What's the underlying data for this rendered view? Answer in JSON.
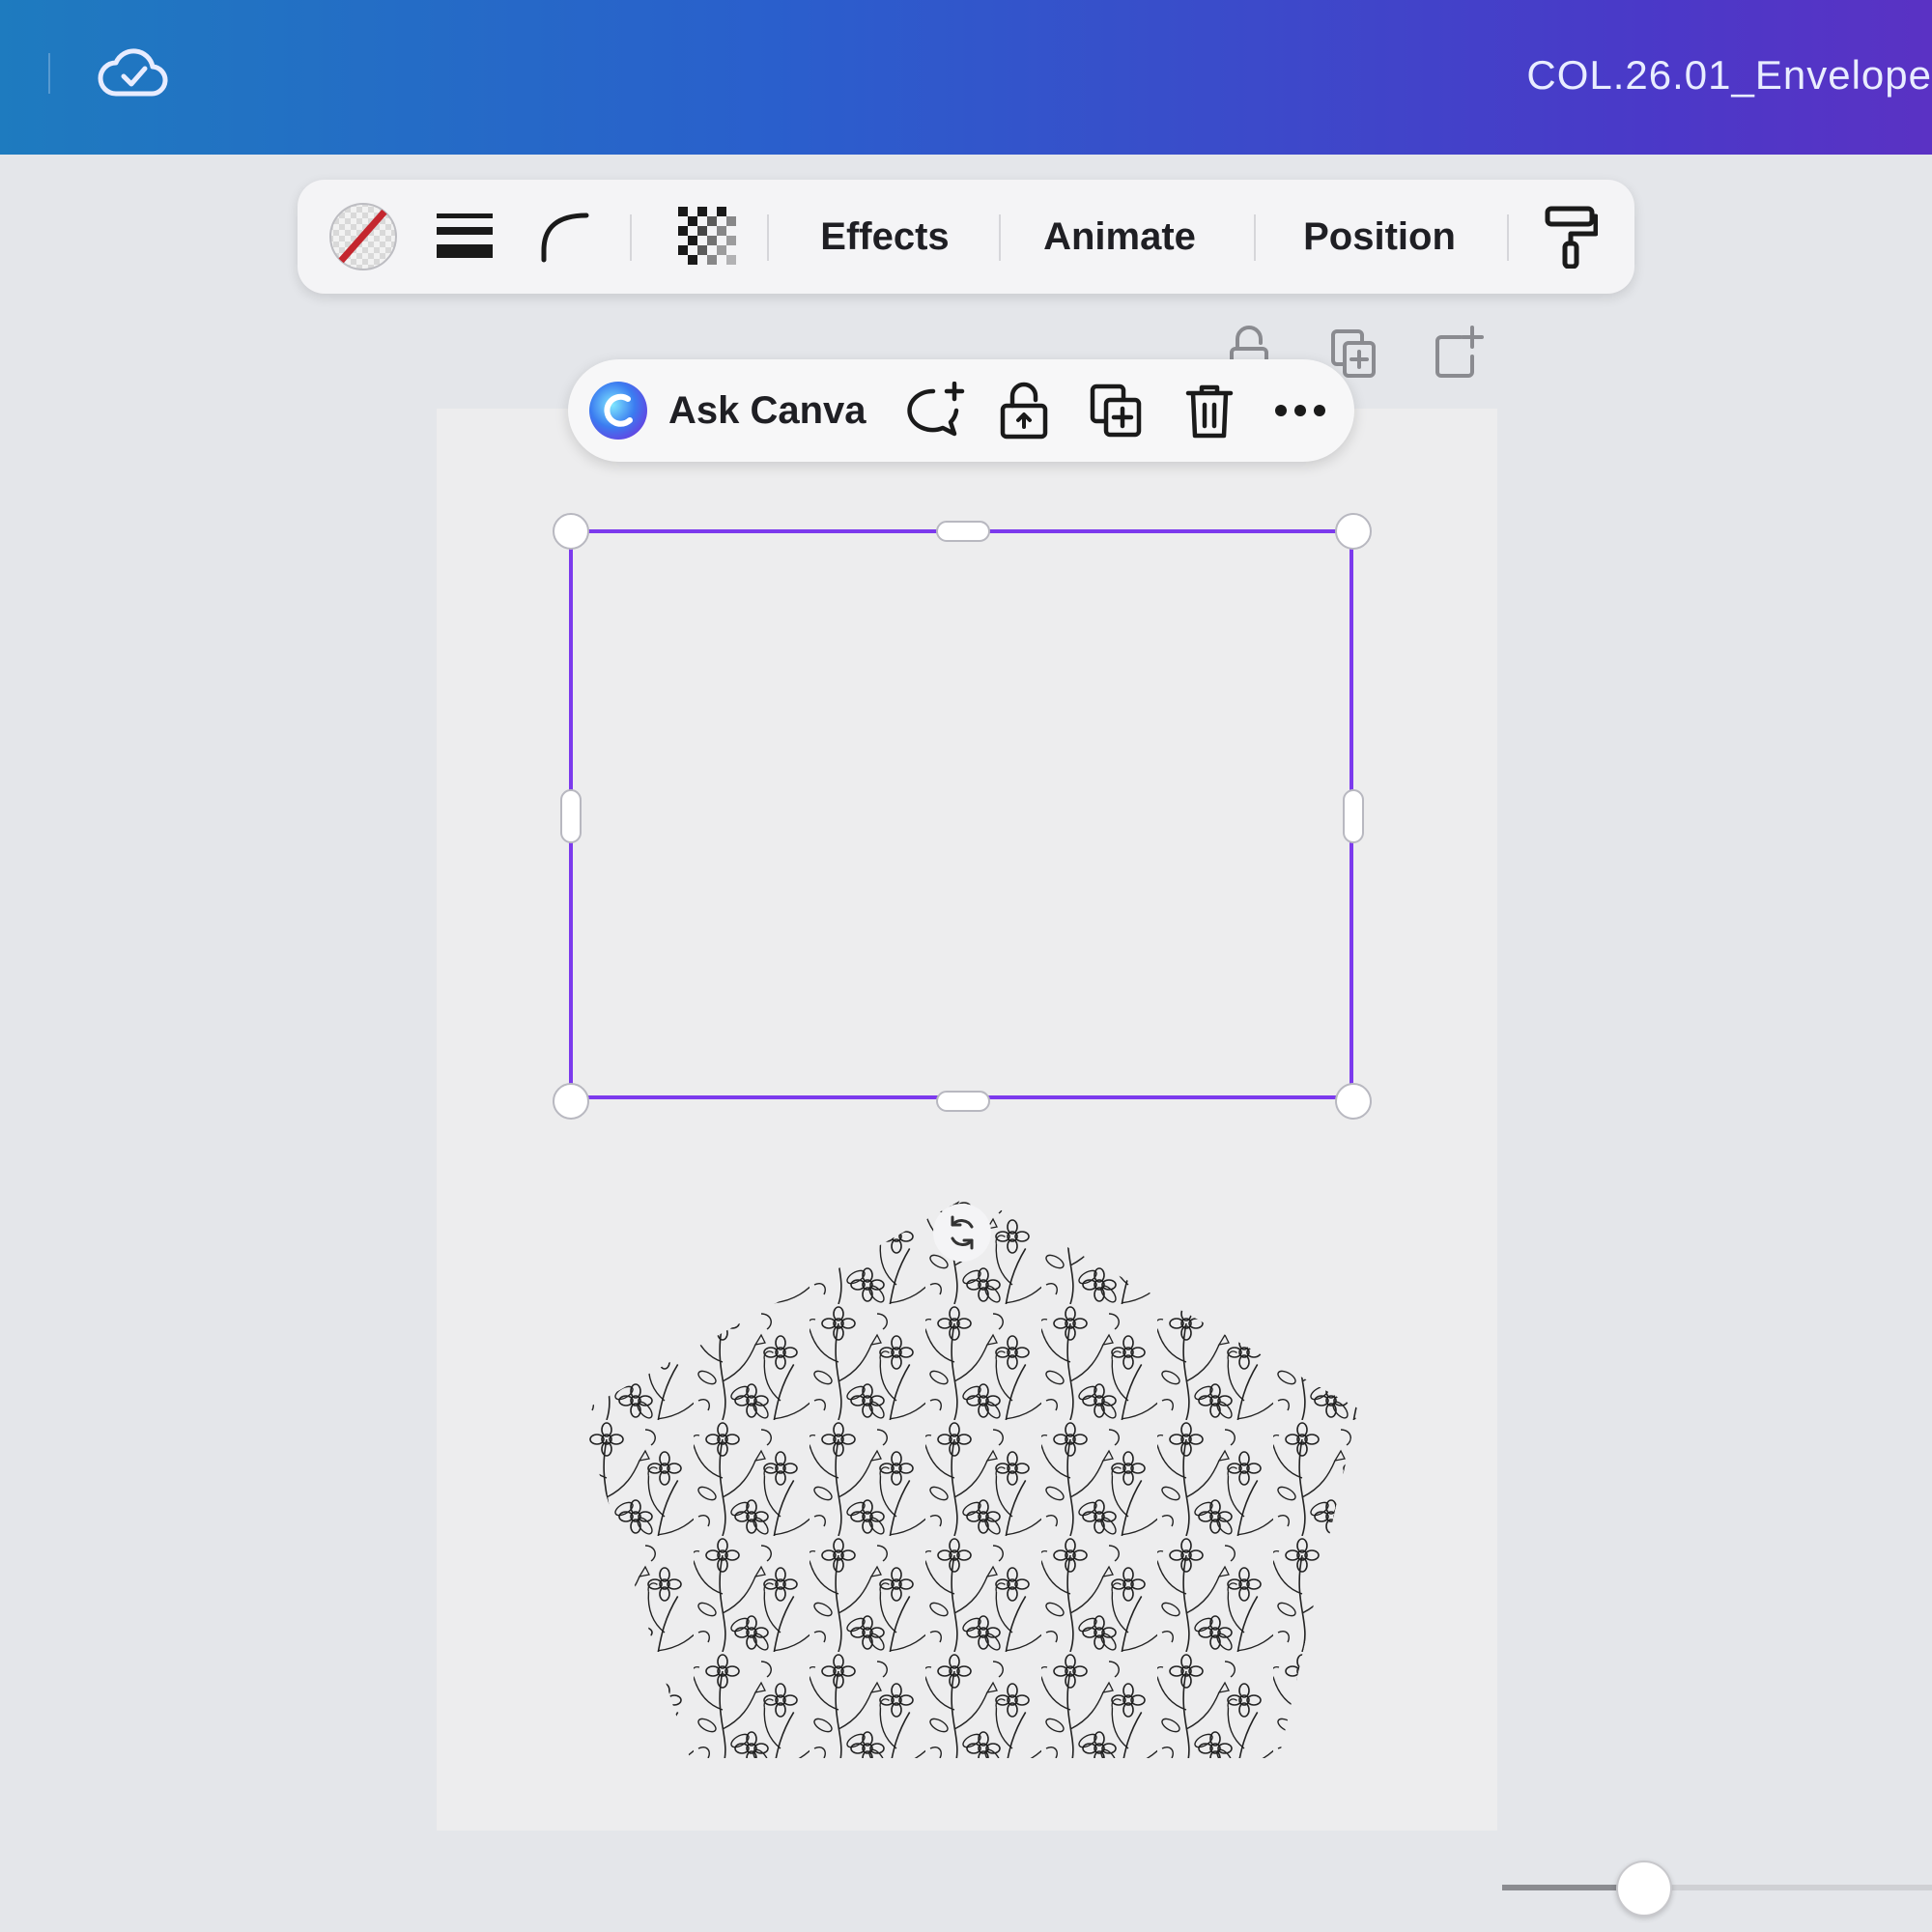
{
  "header": {
    "doc_title": "COL.26.01_Envelope",
    "sync_icon": "cloud-check-icon"
  },
  "toolbar": {
    "border_color_icon": "no-color-swatch-icon",
    "border_style_icon": "border-style-icon",
    "corner_rounding_icon": "corner-rounding-icon",
    "transparency_icon": "transparency-icon",
    "effects_label": "Effects",
    "animate_label": "Animate",
    "position_label": "Position",
    "copy_style_icon": "paint-roller-icon"
  },
  "page_actions": [
    "lock-icon",
    "duplicate-page-icon",
    "add-page-icon"
  ],
  "context_menu": {
    "ask_label": "Ask Canva",
    "items": [
      "comment-add-icon",
      "unlock-icon",
      "duplicate-icon",
      "trash-icon",
      "more-icon"
    ]
  },
  "colors": {
    "header_start": "#1e7bbf",
    "header_end": "#5a32c4",
    "selection": "#7c3aed",
    "canvas_bg": "#e4e6ea",
    "page_bg": "#ededee"
  },
  "zoom": {
    "level_fraction": 0.33
  }
}
